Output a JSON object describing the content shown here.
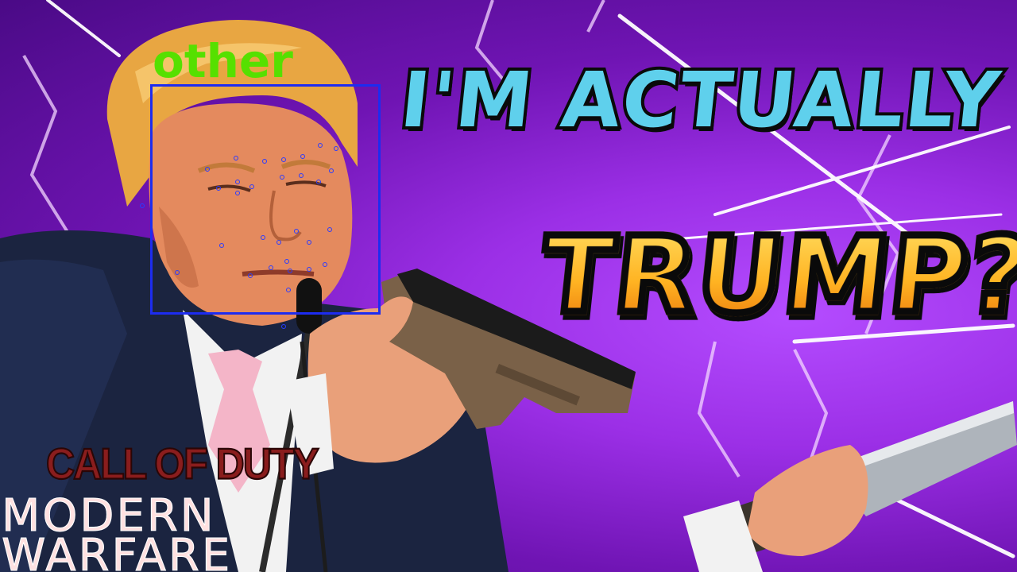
{
  "headline": {
    "line1": "I'M ACTUALLY",
    "line2": "TRUMP??",
    "line1_color": "#5fd0ec",
    "line2_colors": [
      "#ffe267",
      "#ffb322",
      "#e56d07"
    ]
  },
  "face_detection": {
    "label": "other",
    "label_color": "#56e000",
    "box_color": "#1d2cf0",
    "landmark_color": "#2a3cff"
  },
  "game_logo": {
    "brand": "CALL OF DUTY",
    "title_line1": "MODERN",
    "title_line2": "WARFARE"
  },
  "background": {
    "colors": [
      "#b44cff",
      "#9b2fe6",
      "#6f14b3",
      "#4a0a86"
    ]
  }
}
